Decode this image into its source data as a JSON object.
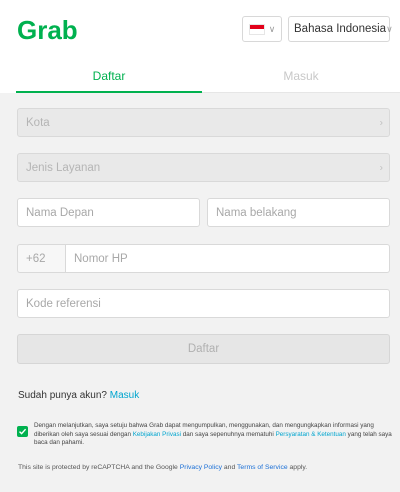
{
  "header": {
    "logo_text": "Grab",
    "language_flag": "indonesia-flag",
    "language": "Bahasa Indonesia"
  },
  "tabs": [
    {
      "label": "Daftar",
      "active": true
    },
    {
      "label": "Masuk",
      "active": false
    }
  ],
  "form": {
    "city_placeholder": "Kota",
    "service_placeholder": "Jenis Layanan",
    "first_name_placeholder": "Nama Depan",
    "last_name_placeholder": "Nama belakang",
    "phone_prefix": "+62",
    "phone_placeholder": "Nomor HP",
    "referral_placeholder": "Kode referensi",
    "submit_label": "Daftar"
  },
  "login_prompt": {
    "text": "Sudah punya akun?",
    "link": "Masuk"
  },
  "consent": {
    "checked": true,
    "part1": "Dengan melanjutkan, saya setuju bahwa Grab dapat mengumpulkan, menggunakan, dan mengungkapkan informasi yang diberikan oleh saya sesuai dengan ",
    "privacy_link": "Kebijakan Privasi",
    "part2": " dan saya sepenuhnya mematuhi ",
    "terms_link": "Persyaratan & Ketentuan",
    "part3": " yang telah saya baca dan pahami."
  },
  "recaptcha": {
    "part1": "This site is protected by reCAPTCHA and the Google ",
    "privacy_link": "Privacy Policy",
    "and": " and ",
    "terms_link": "Terms of Service",
    "part2": " apply."
  },
  "colors": {
    "brand_green": "#00b14f",
    "link_blue": "#00a5cf",
    "flag_red": "#e2001a"
  }
}
